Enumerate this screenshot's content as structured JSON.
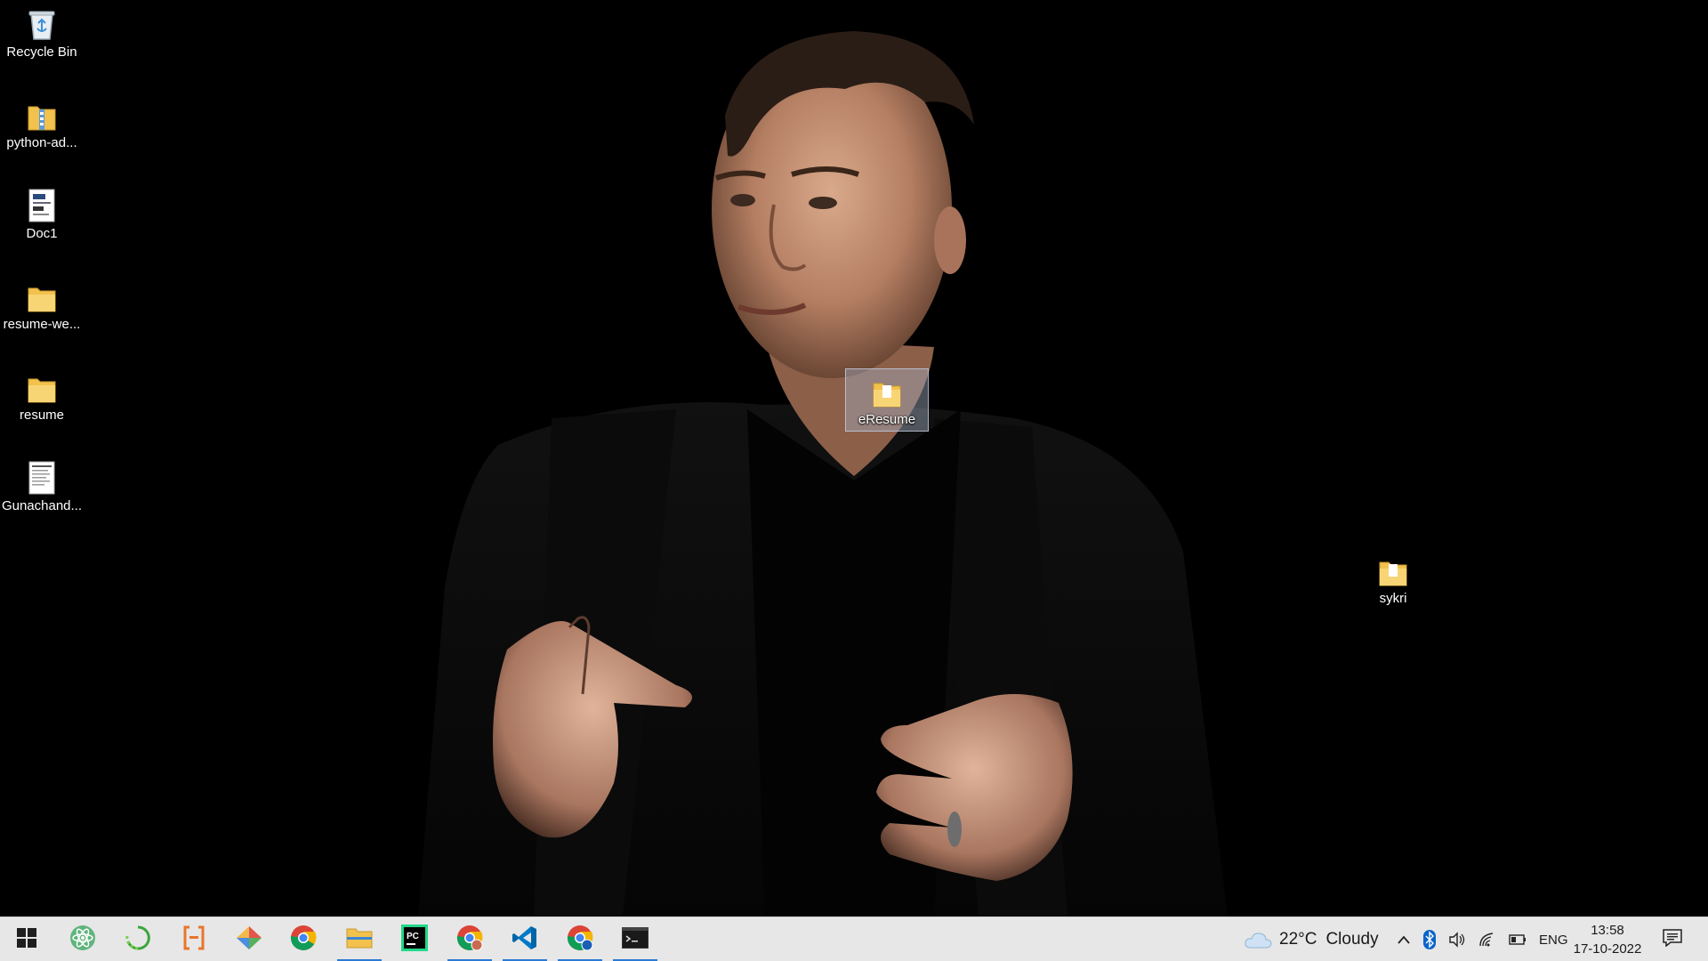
{
  "desktop": {
    "icons": [
      {
        "label": "Recycle Bin",
        "icon": "recycle-bin-icon"
      },
      {
        "label": "python-ad...",
        "icon": "zip-folder-icon"
      },
      {
        "label": "Doc1",
        "icon": "document-icon"
      },
      {
        "label": "resume-we...",
        "icon": "folder-icon"
      },
      {
        "label": "resume",
        "icon": "folder-icon"
      },
      {
        "label": "Gunachand...",
        "icon": "document-icon"
      },
      {
        "label": "eResume",
        "icon": "folder-icon",
        "selected": true
      },
      {
        "label": "sykri",
        "icon": "folder-icon"
      }
    ]
  },
  "taskbar": {
    "pinned": [
      {
        "name": "start",
        "icon": "windows-start-icon"
      },
      {
        "name": "atom",
        "icon": "atom-icon"
      },
      {
        "name": "refresh-app",
        "icon": "circular-arrows-icon"
      },
      {
        "name": "brackets",
        "icon": "brackets-icon"
      },
      {
        "name": "git",
        "icon": "diamond-icon"
      },
      {
        "name": "chrome",
        "icon": "chrome-icon"
      },
      {
        "name": "file-explorer",
        "icon": "folder-icon",
        "active": true
      },
      {
        "name": "pycharm",
        "icon": "pycharm-icon"
      },
      {
        "name": "chrome-profile",
        "icon": "chrome-icon",
        "active": true
      },
      {
        "name": "vscode",
        "icon": "vscode-icon",
        "active": true
      },
      {
        "name": "chrome-alt",
        "icon": "chrome-icon",
        "active": true
      },
      {
        "name": "terminal",
        "icon": "terminal-icon",
        "active": true
      }
    ],
    "weather": {
      "temp": "22°C",
      "condition": "Cloudy",
      "icon": "cloud-icon"
    },
    "language": "ENG",
    "time": "13:58",
    "date": "17-10-2022",
    "accent_color": "#2b7bd4"
  }
}
